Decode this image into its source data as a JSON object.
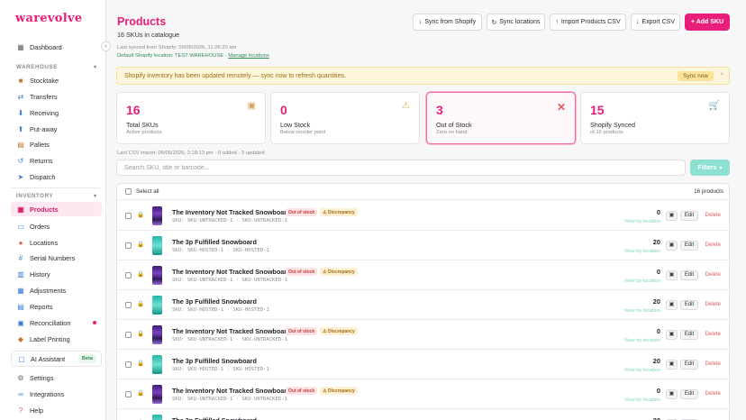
{
  "app": {
    "logo": "warevolve"
  },
  "sidebar": {
    "top_items": [
      {
        "label": "Dashboard",
        "icon": "dashboard-icon"
      }
    ],
    "warehouse_section": "WAREHOUSE",
    "warehouse_items": [
      {
        "label": "Stocktake",
        "icon": "stocktake-icon"
      },
      {
        "label": "Transfers",
        "icon": "transfers-icon"
      },
      {
        "label": "Receiving",
        "icon": "receiving-icon"
      },
      {
        "label": "Put-away",
        "icon": "putaway-icon"
      },
      {
        "label": "Pallets",
        "icon": "pallets-icon"
      },
      {
        "label": "Returns",
        "icon": "returns-icon"
      },
      {
        "label": "Dispatch",
        "icon": "dispatch-icon"
      }
    ],
    "inventory_section": "INVENTORY",
    "inventory_items": [
      {
        "label": "Products",
        "icon": "products-icon",
        "active": true
      },
      {
        "label": "Orders",
        "icon": "orders-icon"
      },
      {
        "label": "Locations",
        "icon": "location-pin-icon"
      },
      {
        "label": "Serial Numbers",
        "icon": "serial-numbers-icon"
      },
      {
        "label": "History",
        "icon": "history-icon"
      },
      {
        "label": "Adjustments",
        "icon": "adjustments-icon"
      },
      {
        "label": "Reports",
        "icon": "reports-icon"
      },
      {
        "label": "Reconciliation",
        "icon": "reconciliation-icon",
        "dot": true
      },
      {
        "label": "Label Printing",
        "icon": "label-printing-icon"
      }
    ],
    "ai_item": {
      "label": "AI Assistant",
      "badge": "Beta"
    },
    "bottom_items": [
      {
        "label": "Settings",
        "icon": "gear-icon"
      },
      {
        "label": "Integrations",
        "icon": "integrations-icon"
      },
      {
        "label": "Help",
        "icon": "help-icon"
      }
    ]
  },
  "header": {
    "title": "Products",
    "subtitle": "16 SKUs in catalogue",
    "last_synced": "Last synced from Shopify: 09/05/2026, 11:26:20 am",
    "location_prefix": "Default Shopify location: TEST WAREHOUSE · ",
    "manage_locations": "Manage locations",
    "buttons": {
      "sync_shopify": "Sync from Shopify",
      "sync_locations": "Sync locations",
      "import_csv": "Import Products CSV",
      "export_csv": "Export CSV",
      "add_sku": "+ Add SKU"
    }
  },
  "banner": {
    "text": "Shopify inventory has been updated remotely — sync now to refresh quantities.",
    "action": "Sync now",
    "close": "×"
  },
  "cards": [
    {
      "number": "16",
      "label": "Total SKUs",
      "desc": "Active products",
      "icon": "box-icon"
    },
    {
      "number": "0",
      "label": "Low Stock",
      "desc": "Below reorder point",
      "icon": "warning-icon"
    },
    {
      "number": "3",
      "label": "Out of Stock",
      "desc": "Zero on hand",
      "icon": "close-x-icon"
    },
    {
      "number": "15",
      "label": "Shopify Synced",
      "desc": "of 16 products",
      "icon": "cart-icon"
    }
  ],
  "csv_import": "Last CSV import: 06/05/2026, 3:18:13 pm · 0 added · 3 updated",
  "search": {
    "placeholder": "Search SKU, title or barcode...",
    "value": ""
  },
  "filters_label": "Filters",
  "table": {
    "select_all": "Select all",
    "count_label": "16 products",
    "view_by_location": "View by location",
    "edit_label": "Edit",
    "delete_label": "Delete",
    "rows": [
      {
        "title": "The Inventory Not Tracked Snowboard",
        "out_of_stock": "Out of stock",
        "discrepancy": "⚠ Discrepancy",
        "sku": "SKU-UNTRACKED-1",
        "variant": "SKU-UNTRACKED-1",
        "qty": "0",
        "thumb": "purple"
      },
      {
        "title": "The 3p Fulfilled Snowboard",
        "out_of_stock": "",
        "discrepancy": "",
        "sku": "SKU-HOSTED-1",
        "variant": "SKU-HOSTED-1",
        "qty": "20",
        "thumb": "teal"
      },
      {
        "title": "The Inventory Not Tracked Snowboard",
        "out_of_stock": "Out of stock",
        "discrepancy": "⚠ Discrepancy",
        "sku": "SKU-UNTRACKED-1",
        "variant": "SKU-UNTRACKED-1",
        "qty": "0",
        "thumb": "purple"
      },
      {
        "title": "The 3p Fulfilled Snowboard",
        "out_of_stock": "",
        "discrepancy": "",
        "sku": "SKU-HOSTED-1",
        "variant": "SKU-HOSTED-1",
        "qty": "20",
        "thumb": "teal"
      },
      {
        "title": "The Inventory Not Tracked Snowboard",
        "out_of_stock": "Out of stock",
        "discrepancy": "⚠ Discrepancy",
        "sku": "SKU-UNTRACKED-1",
        "variant": "SKU-UNTRACKED-1",
        "qty": "0",
        "thumb": "purple"
      },
      {
        "title": "The 3p Fulfilled Snowboard",
        "out_of_stock": "",
        "discrepancy": "",
        "sku": "SKU-HOSTED-1",
        "variant": "SKU-HOSTED-1",
        "qty": "20",
        "thumb": "teal"
      },
      {
        "title": "The Inventory Not Tracked Snowboard",
        "out_of_stock": "Out of stock",
        "discrepancy": "⚠ Discrepancy",
        "sku": "SKU-UNTRACKED-1",
        "variant": "SKU-UNTRACKED-1",
        "qty": "0",
        "thumb": "purple"
      },
      {
        "title": "The 3p Fulfilled Snowboard",
        "out_of_stock": "",
        "discrepancy": "",
        "sku": "SKU-HOSTED-1",
        "variant": "SKU-HOSTED-1",
        "qty": "20",
        "thumb": "teal"
      }
    ]
  },
  "colors": {
    "brand": "#e91e7a",
    "accent_teal": "#8de0d2",
    "warning_bg": "#fdf6dc",
    "danger": "#e05b5b"
  }
}
